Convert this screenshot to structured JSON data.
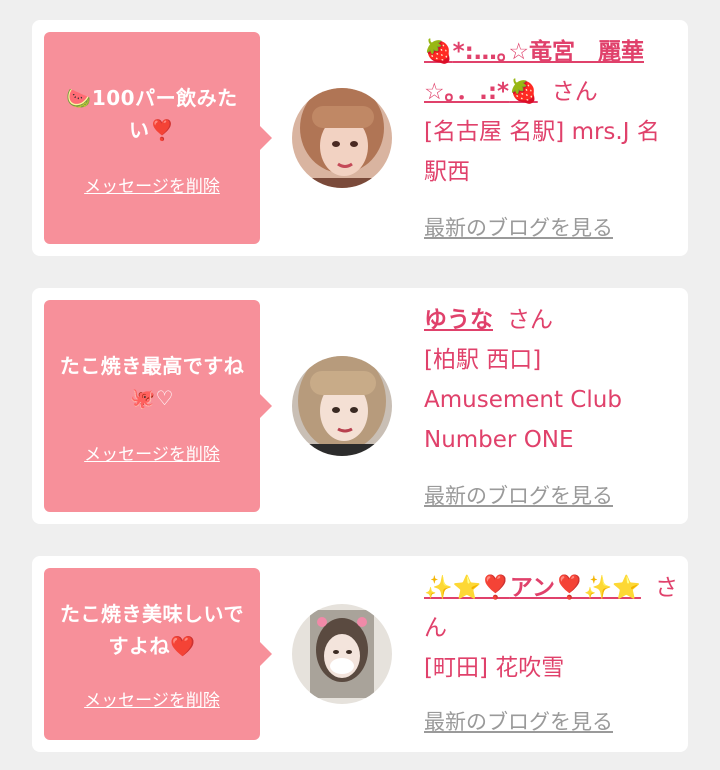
{
  "cards": [
    {
      "message": "🍉100パー飲みたい❣️",
      "delete_label": "メッセージを削除",
      "name_prefix": "🍓",
      "name": "*:…｡☆竜宮　麗華☆｡．.:*",
      "name_suffix": "🍓",
      "honorific": "さん",
      "shop": "[名古屋 名駅] mrs.J 名駅西",
      "blog_link": "最新のブログを見る"
    },
    {
      "message": "たこ焼き最高ですね🐙♡",
      "delete_label": "メッセージを削除",
      "name_prefix": "",
      "name": "ゆうな",
      "name_suffix": "",
      "honorific": "さん",
      "shop": "[柏駅 西口] Amusement Club Number ONE",
      "blog_link": "最新のブログを見る"
    },
    {
      "message": "たこ焼き美味しいですよね❤️",
      "delete_label": "メッセージを削除",
      "name_prefix": "✨⭐❣️",
      "name": "アン",
      "name_suffix": "❣️✨⭐",
      "honorific": "さん",
      "shop": "[町田] 花吹雪",
      "blog_link": "最新のブログを見る"
    }
  ],
  "colors": {
    "background": "#efefef",
    "bubble": "#f7909a",
    "accent": "#e0416b",
    "link_gray": "#9a9a9a"
  }
}
